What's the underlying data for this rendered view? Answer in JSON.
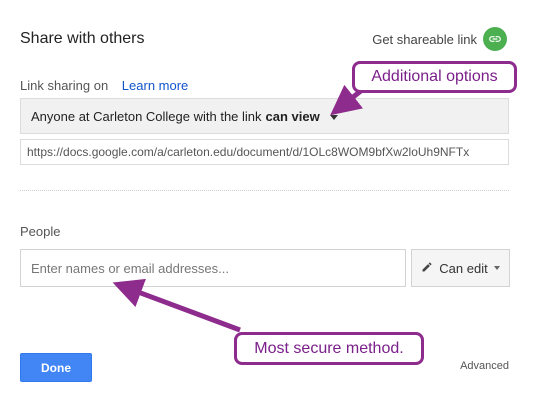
{
  "dialog": {
    "title": "Share with others",
    "get_link_label": "Get shareable link",
    "link_sharing_label": "Link sharing on",
    "learn_more": "Learn more",
    "access_text": "Anyone at Carleton College with the link",
    "access_level": "can view",
    "url": "https://docs.google.com/a/carleton.edu/document/d/1OLc8WOM9bfXw2loUh9NFTx",
    "people_label": "People",
    "people_placeholder": "Enter names or email addresses...",
    "permission_label": "Can edit",
    "done_label": "Done",
    "advanced_label": "Advanced"
  },
  "annotations": {
    "top": "Additional options",
    "bottom": "Most secure method."
  },
  "colors": {
    "annotation": "#8e2c8e",
    "done_button": "#4285f4",
    "link_icon_bg": "#4caf50"
  },
  "icons": {
    "link": "link-icon",
    "pencil": "pencil-icon",
    "caret": "caret-down-icon"
  }
}
